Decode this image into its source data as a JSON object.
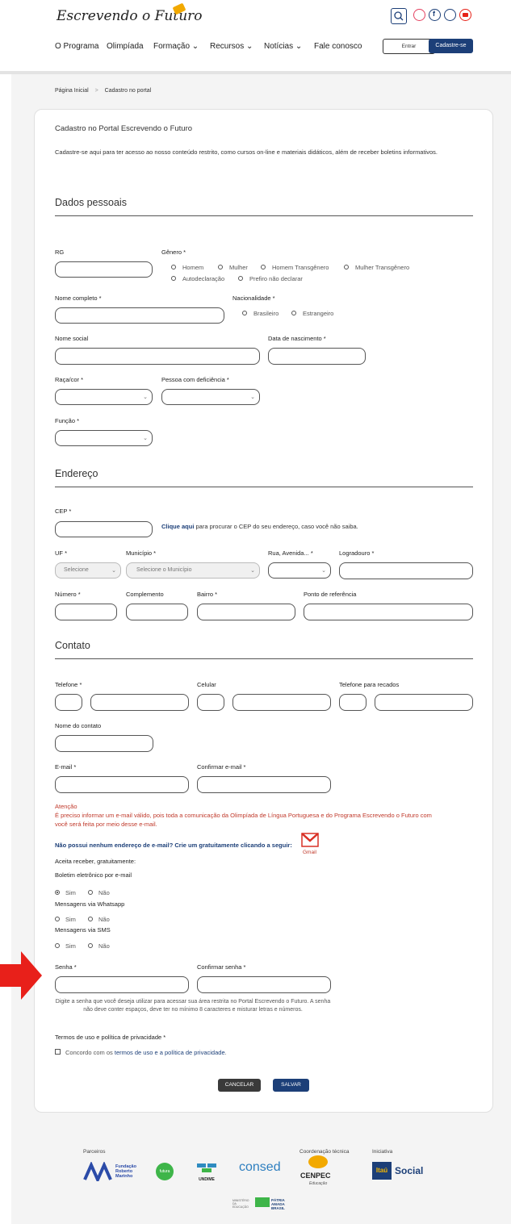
{
  "header": {
    "logo_text": "Escrevendo o Futuro",
    "nav": [
      "O Programa",
      "Olimpíada",
      "Formação ⌄",
      "Recursos ⌄",
      "Notícias ⌄",
      "Fale conosco"
    ],
    "login_label": "Entrar",
    "signup_label": "Cadastre-se",
    "social_icons": [
      "search-icon",
      "instagram-icon",
      "facebook-icon",
      "twitter-icon",
      "youtube-icon"
    ]
  },
  "breadcrumb": {
    "home": "Página Inicial",
    "separator": ">",
    "current": "Cadastro no portal"
  },
  "form": {
    "title": "Cadastro no Portal Escrevendo o Futuro",
    "intro": "Cadastre-se aqui para ter acesso ao nosso conteúdo restrito, como cursos on-line e materiais didáticos, além de receber boletins informativos.",
    "personal": {
      "heading": "Dados pessoais",
      "rg": "RG",
      "gender": "Gênero *",
      "gender_options": [
        "Homem",
        "Mulher",
        "Homem Transgênero",
        "Mulher Transgênero",
        "Autodeclaração",
        "Prefiro não declarar"
      ],
      "full_name": "Nome completo *",
      "nationality": "Nacionalidade *",
      "nationality_options": [
        "Brasileiro",
        "Estrangeiro"
      ],
      "social_name": "Nome social",
      "birth_date": "Data de nascimento *",
      "race": "Raça/cor *",
      "disability": "Pessoa com deficiência *",
      "role": "Função *"
    },
    "address": {
      "heading": "Endereço",
      "cep": "CEP *",
      "cep_link": "Clique aqui",
      "cep_hint": " para procurar o CEP do seu endereço, caso você não saiba.",
      "uf": "UF *",
      "uf_placeholder": "Selecione",
      "municipio": "Município *",
      "municipio_placeholder": "Selecione o Município",
      "street_type": "Rua, Avenida... *",
      "street": "Logradouro *",
      "number": "Número *",
      "complement": "Complemento",
      "district": "Bairro *",
      "reference": "Ponto de referência"
    },
    "contact": {
      "heading": "Contato",
      "phone": "Telefone *",
      "mobile": "Celular",
      "message_phone": "Telefone para recados",
      "contact_name": "Nome do contato",
      "email": "E-mail *",
      "confirm_email": "Confirmar e-mail *",
      "attention_title": "Atenção",
      "attention_text": "É preciso informar um e-mail válido, pois toda a comunicação da Olimpíada de Língua Portuguesa e do Programa Escrevendo o Futuro com você será feita por meio desse e-mail.",
      "no_email": "Não possui nenhum endereço de e-mail? Crie um gratuitamente clicando a seguir:",
      "gmail_label": "Gmail",
      "accept_receive": "Aceita receber, gratuitamente:",
      "newsletter": "Boletim eletrônico por e-mail",
      "whatsapp": "Mensagens via Whatsapp",
      "sms": "Mensagens via SMS",
      "yes": "Sim",
      "no": "Não",
      "password": "Senha *",
      "confirm_password": "Confirmar senha *",
      "password_hint": "Digite a senha que você deseja utilizar para acessar sua área restrita no Portal Escrevendo o Futuro. A senha não deve conter espaços, deve ter no mínimo 8 caracteres e misturar letras e números.",
      "terms_title": "Termos de uso e política de privacidade *",
      "terms_prefix": "Concordo com os ",
      "terms_link": "termos de uso e a política de privacidade",
      "terms_suffix": "."
    },
    "cancel": "CANCELAR",
    "save": "SALVAR"
  },
  "footer": {
    "partners_label": "Parceiros",
    "coordination_label": "Coordenação técnica",
    "initiative_label": "Iniciativa",
    "fundacao": "Fundação Roberto Marinho",
    "futura": "futura",
    "undime": "UNDIME",
    "consed": "consed",
    "cenpec": "CENPEC",
    "cenpec_sub": "Educação",
    "itau_mark": "Itaú",
    "itau_word": "Social",
    "gov": "PÁTRIA AMADA BRASIL",
    "ministry": "MINISTÉRIO DA EDUCAÇÃO"
  },
  "colors": {
    "accent": "#1c3f78",
    "alert": "#c0392b",
    "arrow": "#e8201a"
  }
}
